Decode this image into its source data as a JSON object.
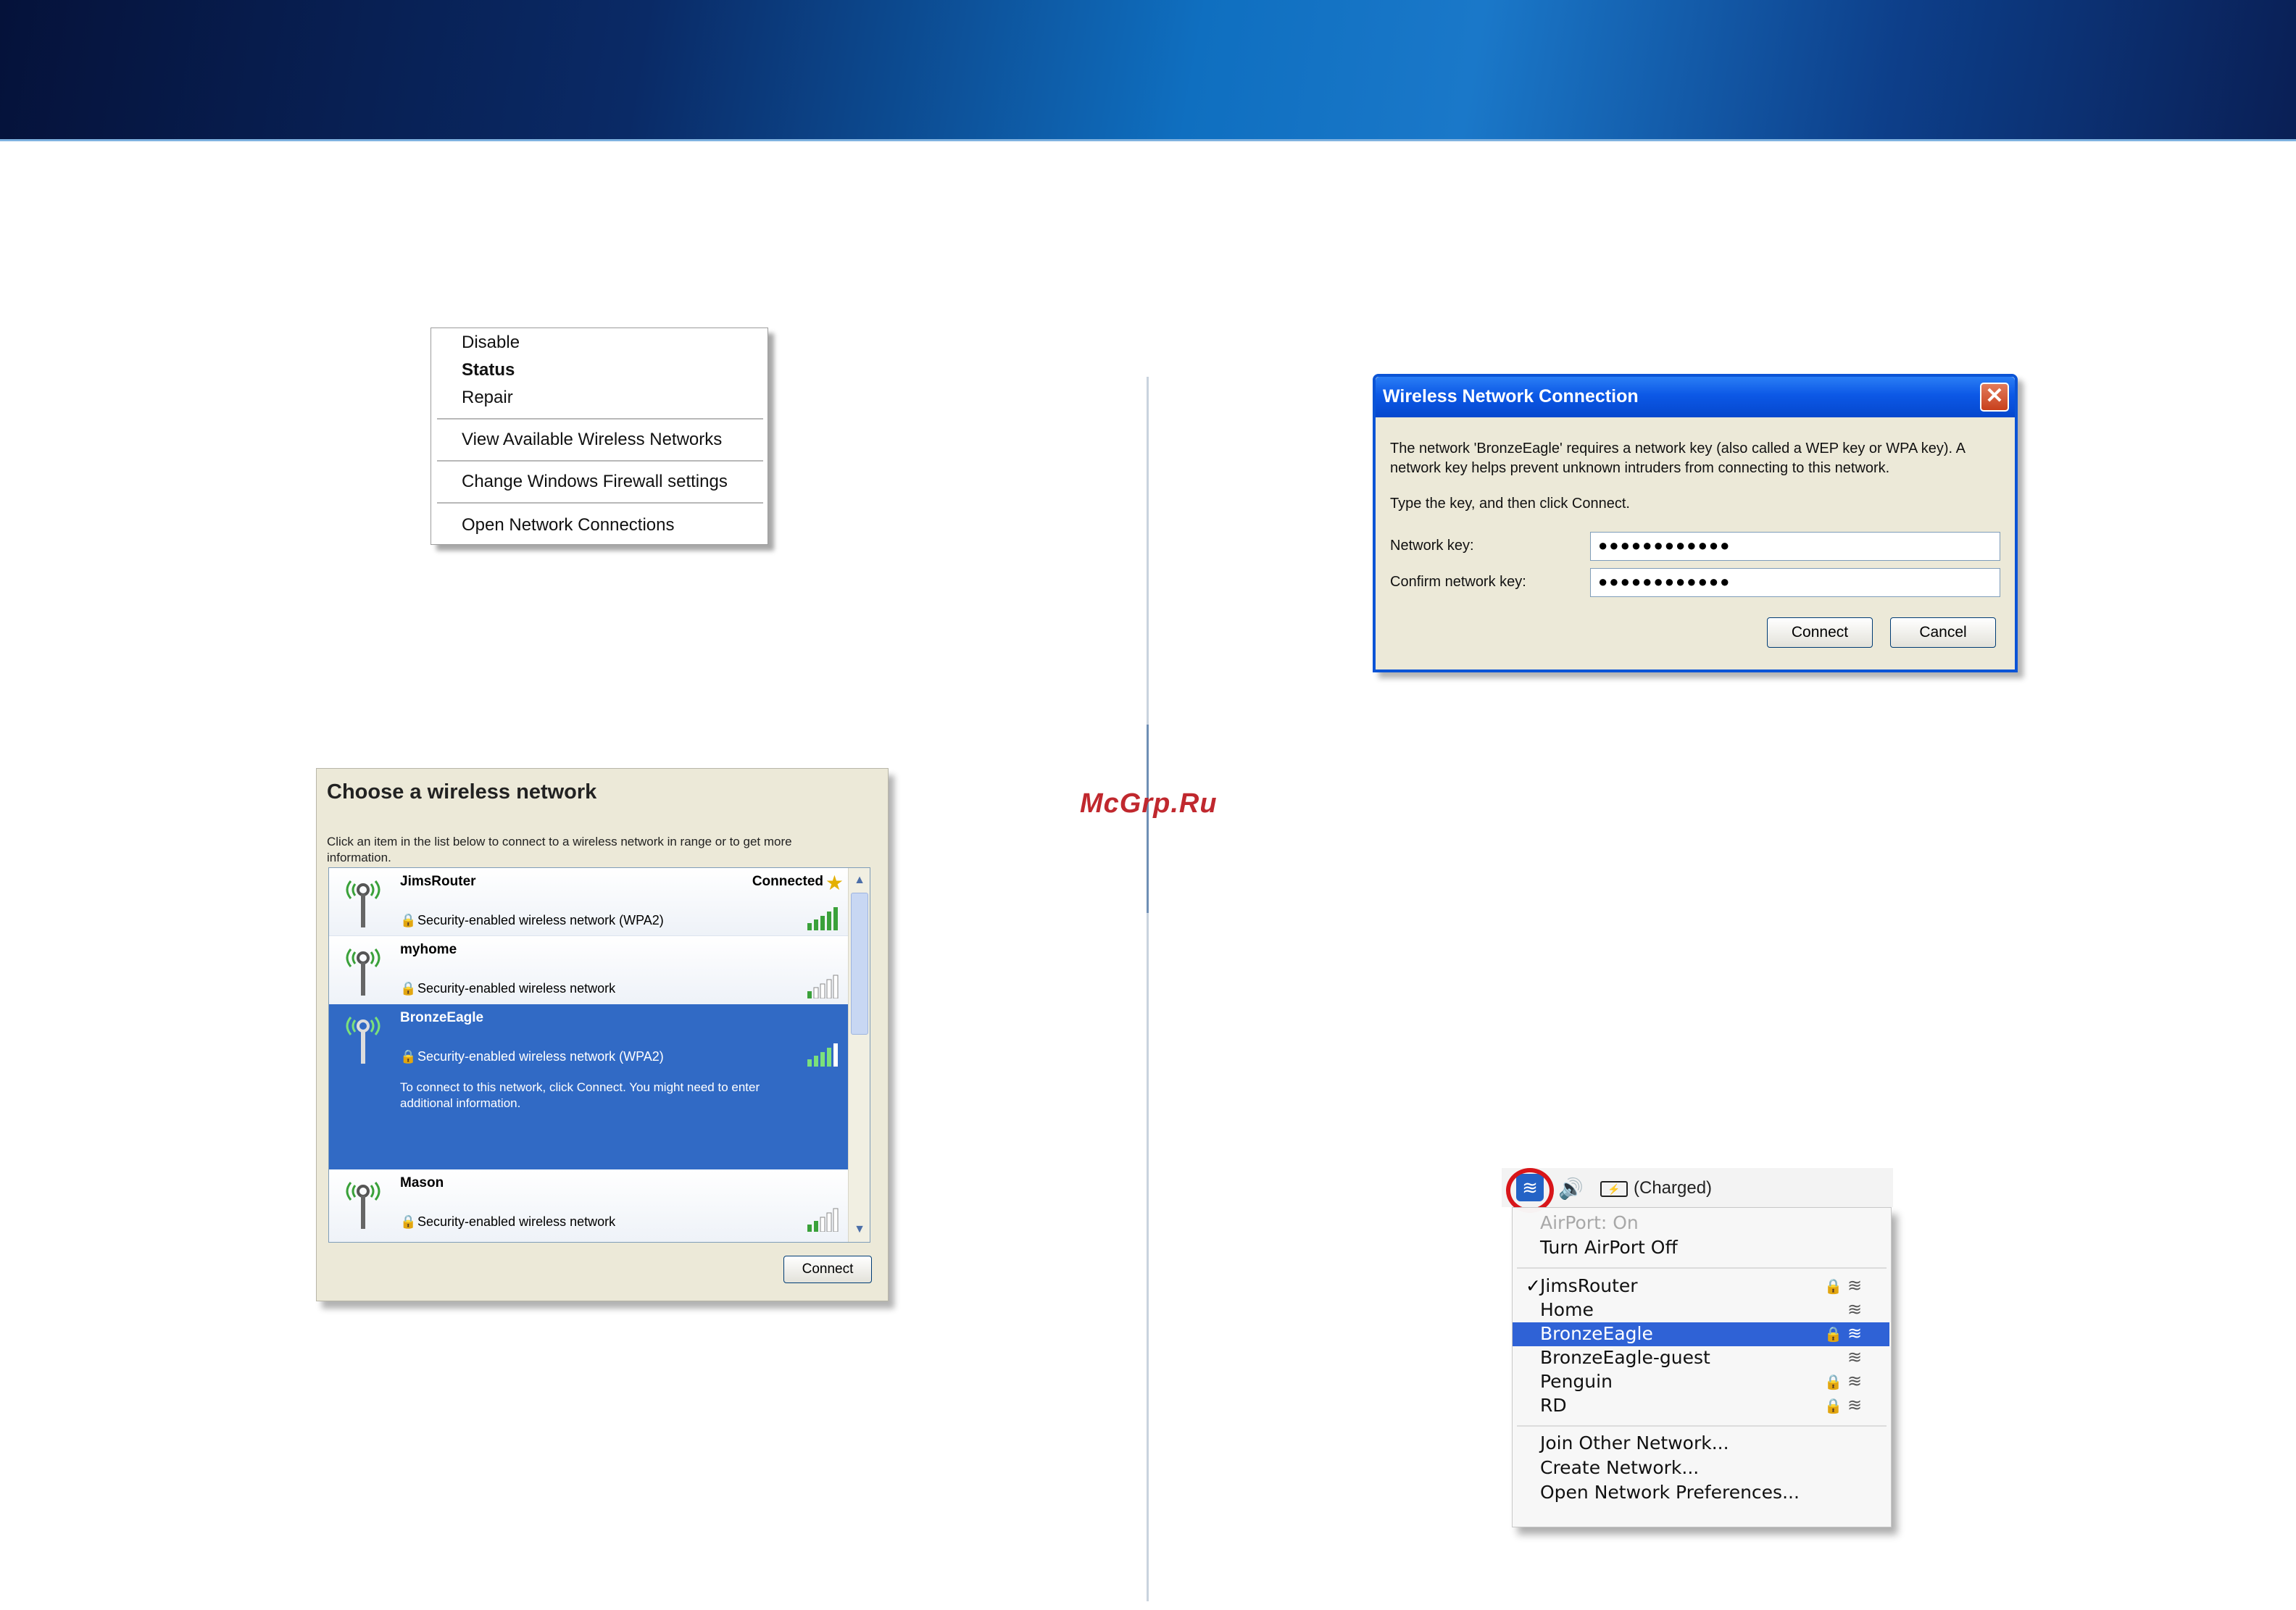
{
  "watermark": "McGrp.Ru",
  "context_menu": {
    "items": [
      "Disable",
      "Status",
      "Repair",
      "View Available Wireless Networks",
      "Change Windows Firewall settings",
      "Open Network Connections"
    ]
  },
  "choose_network": {
    "title": "Choose a wireless network",
    "description": "Click an item in the list below to connect to a wireless network in range or to get more information.",
    "networks": [
      {
        "name": "JimsRouter",
        "status": "Connected",
        "security": "Security-enabled wireless network (WPA2)",
        "extra": ""
      },
      {
        "name": "myhome",
        "status": "",
        "security": "Security-enabled wireless network",
        "extra": ""
      },
      {
        "name": "BronzeEagle",
        "status": "",
        "security": "Security-enabled wireless network (WPA2)",
        "extra": "To connect to this network, click Connect. You might need to enter additional information."
      },
      {
        "name": "Mason",
        "status": "",
        "security": "Security-enabled wireless network",
        "extra": ""
      }
    ],
    "connect_label": "Connect"
  },
  "wireless_dialog": {
    "title": "Wireless Network Connection",
    "message": "The network 'BronzeEagle' requires a network key (also called a WEP key or WPA key). A network key helps prevent unknown intruders from connecting to this network.",
    "instruction": "Type the key, and then click Connect.",
    "network_key_label": "Network key:",
    "network_key_value": "●●●●●●●●●●●●",
    "confirm_key_label": "Confirm network key:",
    "confirm_key_value": "●●●●●●●●●●●●",
    "connect_label": "Connect",
    "cancel_label": "Cancel"
  },
  "mac_menu": {
    "battery_status": "(Charged)",
    "airport_status": "AirPort: On",
    "airport_toggle": "Turn AirPort Off",
    "networks": [
      {
        "name": "JimsRouter",
        "checked": "✓",
        "locked": "🔒"
      },
      {
        "name": "Home",
        "checked": "",
        "locked": ""
      },
      {
        "name": "BronzeEagle",
        "checked": "",
        "locked": "🔒"
      },
      {
        "name": "BronzeEagle-guest",
        "checked": "",
        "locked": ""
      },
      {
        "name": "Penguin",
        "checked": "",
        "locked": "🔒"
      },
      {
        "name": "RD",
        "checked": "",
        "locked": "🔒"
      }
    ],
    "join_other": "Join Other Network...",
    "create_network": "Create Network...",
    "open_prefs": "Open Network Preferences..."
  }
}
